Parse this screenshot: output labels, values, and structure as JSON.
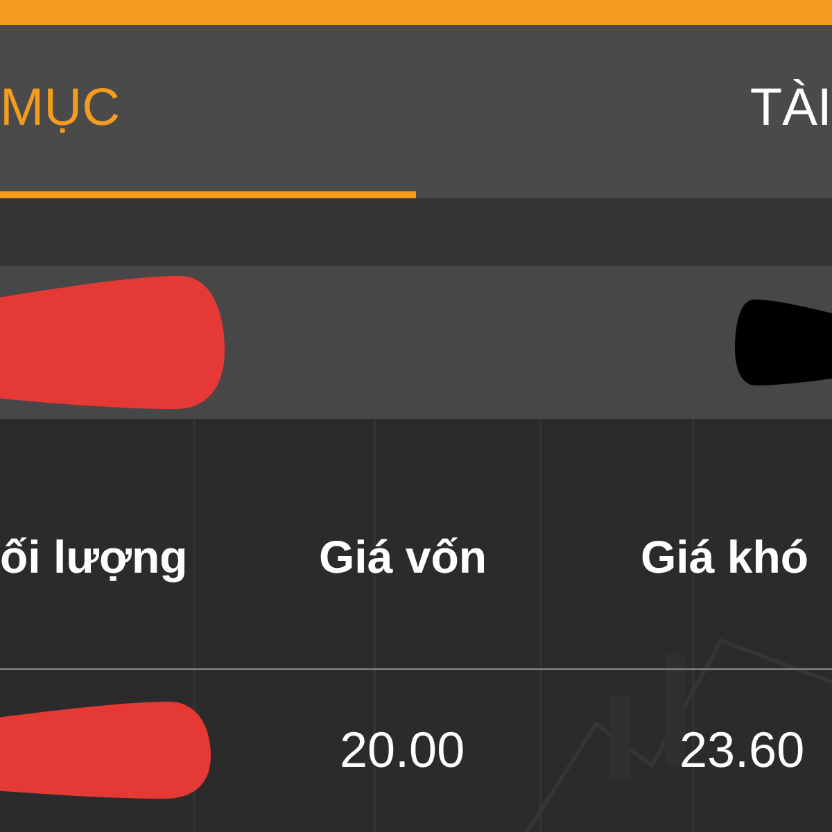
{
  "tabs": [
    {
      "label": "MỤC",
      "selected": true
    },
    {
      "label": "TÀI",
      "selected": false
    }
  ],
  "table": {
    "columns": [
      "ối lượng",
      "Giá vốn",
      "Giá khó"
    ],
    "rows": [
      {
        "cost_price": "20.00",
        "column_3": "23.60"
      }
    ]
  }
}
